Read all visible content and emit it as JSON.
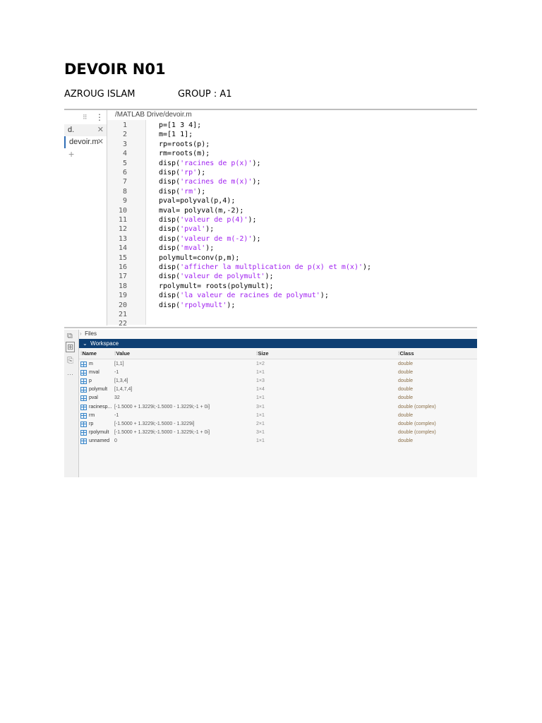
{
  "document": {
    "title": "DEVOIR N01",
    "author": "AZROUG ISLAM",
    "group": "GROUP : A1"
  },
  "editor": {
    "path": "/MATLAB Drive/devoir.m",
    "file_tabs": [
      {
        "label": "d."
      },
      {
        "label": "devoir.m"
      }
    ],
    "lines": [
      [
        {
          "t": "p=[1 3 4];"
        }
      ],
      [
        {
          "t": "m=[1 1];"
        }
      ],
      [
        {
          "t": "rp=roots(p);"
        }
      ],
      [
        {
          "t": "rm=roots(m);"
        }
      ],
      [
        {
          "t": "disp("
        },
        {
          "s": "'racines de p(x)'"
        },
        {
          "t": ");"
        }
      ],
      [
        {
          "t": "disp("
        },
        {
          "s": "'rp'"
        },
        {
          "t": ");"
        }
      ],
      [
        {
          "t": "disp("
        },
        {
          "s": "'racines de m(x)'"
        },
        {
          "t": ");"
        }
      ],
      [
        {
          "t": "disp("
        },
        {
          "s": "'rm'"
        },
        {
          "t": ");"
        }
      ],
      [
        {
          "t": "pval=polyval(p,4);"
        }
      ],
      [
        {
          "t": "mval= polyval(m,-2);"
        }
      ],
      [
        {
          "t": "disp("
        },
        {
          "s": "'valeur de p(4)'"
        },
        {
          "t": ");"
        }
      ],
      [
        {
          "t": "disp("
        },
        {
          "s": "'pval'"
        },
        {
          "t": ");"
        }
      ],
      [
        {
          "t": "disp("
        },
        {
          "s": "'valeur de m(-2)'"
        },
        {
          "t": ");"
        }
      ],
      [
        {
          "t": "disp("
        },
        {
          "s": "'mval'"
        },
        {
          "t": ");"
        }
      ],
      [
        {
          "t": "polymult=conv(p,m);"
        }
      ],
      [
        {
          "t": "disp("
        },
        {
          "s": "'afficher la multplication de p(x) et m(x)'"
        },
        {
          "t": ");"
        }
      ],
      [
        {
          "t": "disp("
        },
        {
          "s": "'valeur de polymult'"
        },
        {
          "t": ");"
        }
      ],
      [
        {
          "t": "rpolymult= roots(polymult);"
        }
      ],
      [
        {
          "t": "disp("
        },
        {
          "s": "'la valeur de racines de polymut'"
        },
        {
          "t": ");"
        }
      ],
      [
        {
          "t": "disp("
        },
        {
          "s": "'rpolymult'"
        },
        {
          "t": ");"
        }
      ],
      []
    ],
    "string_color": "#a020f0"
  },
  "workspace": {
    "files_label": "Files",
    "title": "Workspace",
    "header_color": "#0e3f73",
    "columns": {
      "name": "Name",
      "value": "Value",
      "size": "Size",
      "class": "Class"
    },
    "rows": [
      {
        "name": "m",
        "value": "[1,1]",
        "size": "1×2",
        "class": "double"
      },
      {
        "name": "mval",
        "value": "-1",
        "size": "1×1",
        "class": "double"
      },
      {
        "name": "p",
        "value": "[1,3,4]",
        "size": "1×3",
        "class": "double"
      },
      {
        "name": "polymult",
        "value": "[1,4,7,4]",
        "size": "1×4",
        "class": "double"
      },
      {
        "name": "pval",
        "value": "32",
        "size": "1×1",
        "class": "double"
      },
      {
        "name": "racinesp...",
        "value": "[-1.5000 + 1.3229i;-1.5000 - 1.3229i;-1 + 0i]",
        "size": "3×1",
        "class": "double (complex)"
      },
      {
        "name": "rm",
        "value": "-1",
        "size": "1×1",
        "class": "double"
      },
      {
        "name": "rp",
        "value": "[-1.5000 + 1.3229i;-1.5000 - 1.3229i]",
        "size": "2×1",
        "class": "double (complex)"
      },
      {
        "name": "rpolymult",
        "value": "[-1.5000 + 1.3229i;-1.5000 - 1.3229i;-1 + 0i]",
        "size": "3×1",
        "class": "double (complex)"
      },
      {
        "name": "unnamed",
        "value": "0",
        "size": "1×1",
        "class": "double"
      }
    ]
  }
}
